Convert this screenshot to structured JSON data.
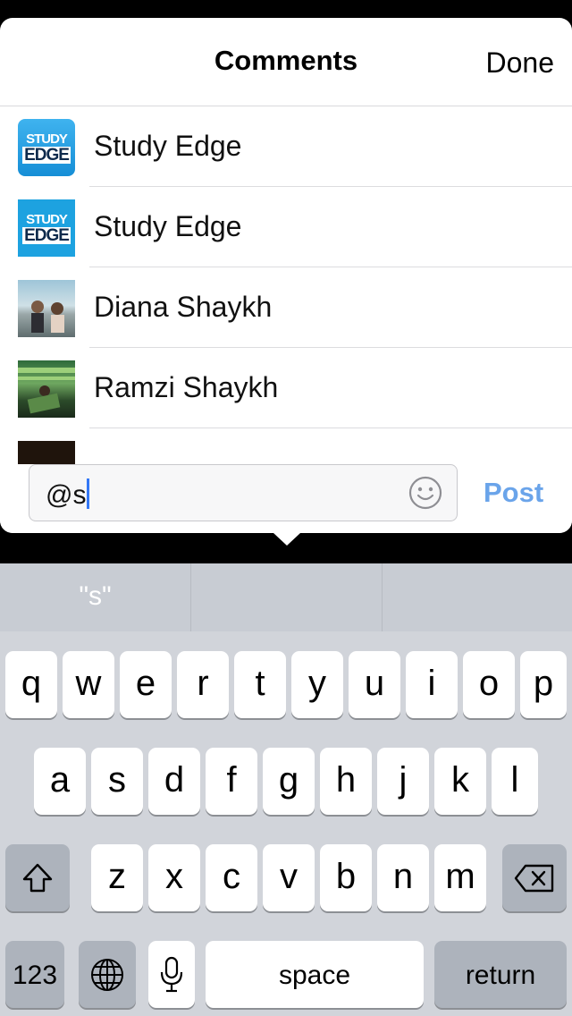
{
  "header": {
    "title": "Comments",
    "done_label": "Done"
  },
  "suggestions": [
    {
      "name": "Study Edge",
      "avatar": "study-edge-logo"
    },
    {
      "name": "Study Edge",
      "avatar": "study-edge-logo"
    },
    {
      "name": "Diana Shaykh",
      "avatar": "photo"
    },
    {
      "name": "Ramzi Shaykh",
      "avatar": "photo"
    }
  ],
  "logo_text": {
    "line1": "STUDY",
    "line2": "EDGE"
  },
  "comment_input": {
    "value": "@s"
  },
  "post_label": "Post",
  "keyboard": {
    "prediction": "\"s\"",
    "row1": [
      "q",
      "w",
      "e",
      "r",
      "t",
      "y",
      "u",
      "i",
      "o",
      "p"
    ],
    "row2": [
      "a",
      "s",
      "d",
      "f",
      "g",
      "h",
      "j",
      "k",
      "l"
    ],
    "row3": [
      "z",
      "x",
      "c",
      "v",
      "b",
      "n",
      "m"
    ],
    "numbers_label": "123",
    "space_label": "space",
    "return_label": "return"
  },
  "colors": {
    "accent": "#6aa4ea",
    "caret": "#3478f6"
  }
}
